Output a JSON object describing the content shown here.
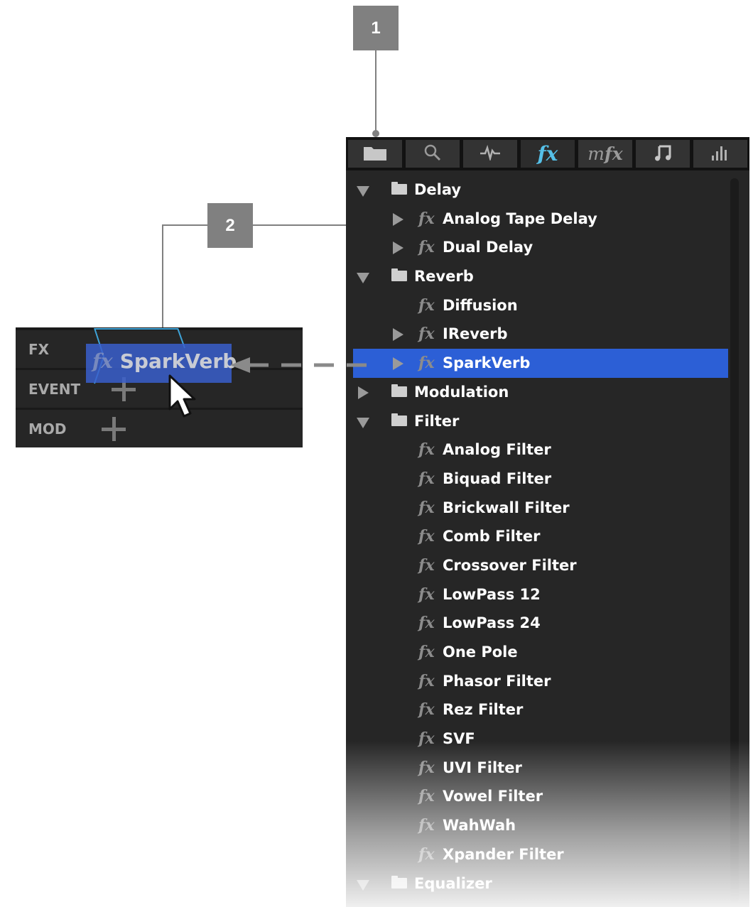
{
  "callouts": {
    "one": "1",
    "two": "2"
  },
  "tabs": [
    {
      "icon": "folder-icon"
    },
    {
      "icon": "search-icon"
    },
    {
      "icon": "waveform-icon"
    },
    {
      "icon": "fx-icon",
      "label": "fx",
      "active": true
    },
    {
      "icon": "mfx-icon",
      "label_m": "m",
      "label_fx": "fx"
    },
    {
      "icon": "music-note-icon"
    },
    {
      "icon": "bars-icon"
    }
  ],
  "tree": [
    {
      "type": "folder",
      "label": "Delay",
      "expanded": true
    },
    {
      "type": "fx",
      "label": "Analog Tape Delay",
      "has_children": true
    },
    {
      "type": "fx",
      "label": "Dual Delay",
      "has_children": true
    },
    {
      "type": "folder",
      "label": "Reverb",
      "expanded": true
    },
    {
      "type": "fx",
      "label": "Diffusion",
      "has_children": false
    },
    {
      "type": "fx",
      "label": "IReverb",
      "has_children": true
    },
    {
      "type": "fx",
      "label": "SparkVerb",
      "has_children": true,
      "selected": true
    },
    {
      "type": "folder",
      "label": "Modulation",
      "expanded": false
    },
    {
      "type": "folder",
      "label": "Filter",
      "expanded": true
    },
    {
      "type": "fx",
      "label": "Analog Filter"
    },
    {
      "type": "fx",
      "label": "Biquad Filter"
    },
    {
      "type": "fx",
      "label": "Brickwall Filter"
    },
    {
      "type": "fx",
      "label": "Comb Filter"
    },
    {
      "type": "fx",
      "label": "Crossover Filter"
    },
    {
      "type": "fx",
      "label": "LowPass 12"
    },
    {
      "type": "fx",
      "label": "LowPass 24"
    },
    {
      "type": "fx",
      "label": "One Pole"
    },
    {
      "type": "fx",
      "label": "Phasor Filter"
    },
    {
      "type": "fx",
      "label": "Rez Filter"
    },
    {
      "type": "fx",
      "label": "SVF"
    },
    {
      "type": "fx",
      "label": "UVI Filter"
    },
    {
      "type": "fx",
      "label": "Vowel Filter"
    },
    {
      "type": "fx",
      "label": "WahWah"
    },
    {
      "type": "fx",
      "label": "Xpander Filter"
    },
    {
      "type": "folder",
      "label": "Equalizer",
      "expanded": true
    }
  ],
  "fx_glyph": "fx",
  "slots": {
    "fx": "FX",
    "event": "EVENT",
    "mod": "MOD"
  },
  "drag": {
    "glyph": "fx",
    "label": "SparkVerb"
  },
  "colors": {
    "selected": "#2c5fd6",
    "accent": "#55c0e8"
  }
}
